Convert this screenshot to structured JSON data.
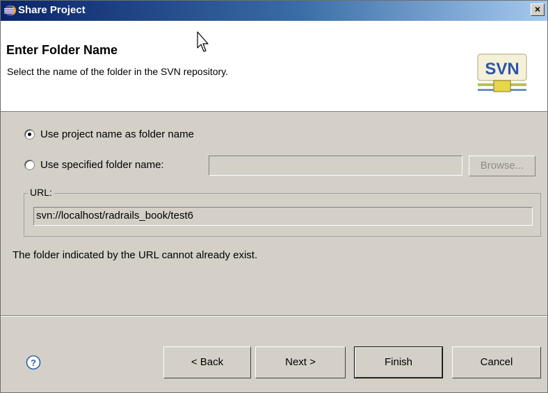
{
  "window": {
    "title": "Share Project",
    "close_label": "×"
  },
  "header": {
    "title": "Enter Folder Name",
    "description": "Select the name of the folder in the SVN repository.",
    "logo_text": "SVN",
    "logo_icon": "svn-logo-icon"
  },
  "options": {
    "use_project_name": {
      "label": "Use project name as folder name",
      "checked": true
    },
    "use_specified_name": {
      "label": "Use specified folder name:",
      "checked": false
    }
  },
  "folder_input": {
    "value": ""
  },
  "browse_label": "Browse...",
  "url_group": {
    "legend": "URL:",
    "value": "svn://localhost/radrails_book/test6"
  },
  "info_text": "The folder indicated by the URL cannot already exist.",
  "buttons": {
    "help_icon": "help-icon",
    "back_label": "< Back",
    "next_label": "Next >",
    "finish_label": "Finish",
    "cancel_label": "Cancel"
  },
  "colors": {
    "titlebar_start": "#0a246a",
    "titlebar_end": "#a6caf0",
    "dialog_bg": "#d4d0c8",
    "disabled_text": "#8e8c86",
    "help_blue": "#2f5fb3"
  }
}
